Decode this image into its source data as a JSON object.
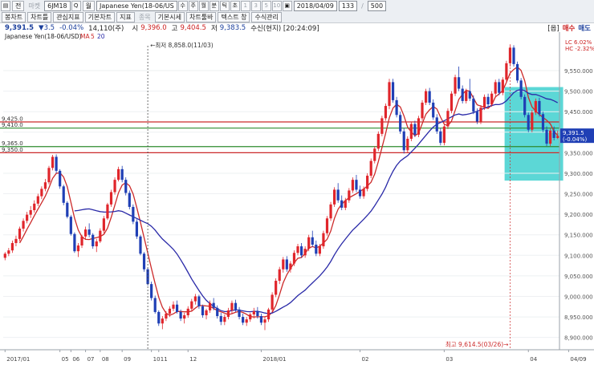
{
  "toolbar": {
    "items": [
      {
        "label": "▤",
        "kind": "sq"
      },
      {
        "label": "전",
        "kind": "btn"
      },
      {
        "label": "마켓",
        "kind": "dim"
      },
      {
        "label": "6JM18",
        "kind": "box"
      },
      {
        "label": "Q",
        "kind": "sq"
      },
      {
        "label": "월",
        "kind": "btn"
      },
      {
        "label": "Japanese Yen(18-06/US",
        "kind": "box"
      },
      {
        "label": "수",
        "kind": "sq"
      },
      {
        "label": "주",
        "kind": "sq"
      },
      {
        "label": "월",
        "kind": "sq"
      },
      {
        "label": "분",
        "kind": "sq"
      },
      {
        "label": "틱",
        "kind": "sq"
      },
      {
        "label": "초",
        "kind": "sq"
      },
      {
        "label": "1",
        "kind": "sqdim"
      },
      {
        "label": "3",
        "kind": "sqdim"
      },
      {
        "label": "5",
        "kind": "sqdim"
      },
      {
        "label": "10",
        "kind": "sqdim"
      },
      {
        "label": "▣",
        "kind": "sq"
      },
      {
        "label": "2018/04/09",
        "kind": "box"
      },
      {
        "label": "133",
        "kind": "box"
      },
      {
        "label": "/",
        "kind": "dim"
      },
      {
        "label": "500",
        "kind": "box"
      }
    ],
    "items2": [
      {
        "label": "봉차트",
        "kind": "btn"
      },
      {
        "label": "차트틀",
        "kind": "btn"
      },
      {
        "label": "관심지표",
        "kind": "btn"
      },
      {
        "label": "기본차트",
        "kind": "btn"
      },
      {
        "label": "지표",
        "kind": "btn"
      },
      {
        "label": "종목",
        "kind": "dim"
      },
      {
        "label": "기본시세",
        "kind": "btn"
      },
      {
        "label": "차트툴바",
        "kind": "btn"
      },
      {
        "label": "텍스트 창",
        "kind": "btn"
      },
      {
        "label": "수식관리",
        "kind": "btn"
      }
    ]
  },
  "quote": {
    "price": "9,391.5",
    "change": "▼3.5",
    "pct": "-0.04%",
    "volume": "14,110(주)",
    "open_label": "시",
    "open": "9,396.0",
    "high_label": "고",
    "high": "9,404.5",
    "low_label": "저",
    "low": "9,383.5",
    "session": "수신(현지) [20:24:09]",
    "menu": "[옵]",
    "buy": "매수",
    "sell": "매도"
  },
  "chart_data": {
    "type": "candlestick",
    "instrument": "Japanese Yen(18-06/USD)",
    "legend": [
      {
        "label": "MA",
        "periods": "5",
        "color": "#cc2a2a"
      },
      {
        "label": "20",
        "color": "#2a2aa8"
      }
    ],
    "ylim": [
      8870,
      9640
    ],
    "yticks": [
      8900,
      8950,
      9000,
      9050,
      9100,
      9150,
      9200,
      9250,
      9300,
      9350,
      9400,
      9450,
      9500,
      9550
    ],
    "x_labels": [
      {
        "i": 0,
        "label": "2017/01"
      },
      {
        "i": 15,
        "label": "05"
      },
      {
        "i": 18,
        "label": "06"
      },
      {
        "i": 22,
        "label": "07"
      },
      {
        "i": 26,
        "label": "08"
      },
      {
        "i": 32,
        "label": "09"
      },
      {
        "i": 40,
        "label": "10"
      },
      {
        "i": 42,
        "label": "11"
      },
      {
        "i": 50,
        "label": "12"
      },
      {
        "i": 70,
        "label": "2018/01"
      },
      {
        "i": 97,
        "label": "02"
      },
      {
        "i": 120,
        "label": "03"
      },
      {
        "i": 143,
        "label": "04"
      },
      {
        "i": 154,
        "label": "04/09"
      }
    ],
    "h_levels": [
      {
        "value": 9425.0,
        "color": "#cc2a2a"
      },
      {
        "value": 9410.0,
        "color": "#2e8b2e"
      },
      {
        "value": 9365.0,
        "color": "#2e8b2e"
      },
      {
        "value": 9350.0,
        "color": "#cc2a2a"
      }
    ],
    "h_level_labels": [
      "9,425.0",
      "9,410.0",
      "9,365.0",
      "9,350.0"
    ],
    "annotations": {
      "low": {
        "i": 39,
        "text": "최저 8,858.0(11/03)"
      },
      "high": {
        "i": 138,
        "text": "최고 9,614.5(03/26)"
      }
    },
    "current": {
      "price_text": "9,391.5",
      "change_text": "(-0.04%)",
      "value": 9391.5
    },
    "side_labels": [
      "LC 6.02%",
      "HC -2.32%"
    ],
    "highlight": {
      "i0": 137,
      "i1": 152,
      "hi": 9510,
      "lo": 9282
    },
    "candles": [
      [
        9094,
        9108,
        9088,
        9104
      ],
      [
        9104,
        9118,
        9098,
        9112
      ],
      [
        9112,
        9136,
        9106,
        9130
      ],
      [
        9130,
        9148,
        9122,
        9140
      ],
      [
        9140,
        9170,
        9134,
        9165
      ],
      [
        9165,
        9190,
        9158,
        9184
      ],
      [
        9184,
        9206,
        9178,
        9199
      ],
      [
        9199,
        9220,
        9191,
        9210
      ],
      [
        9210,
        9234,
        9204,
        9226
      ],
      [
        9226,
        9250,
        9220,
        9244
      ],
      [
        9244,
        9268,
        9237,
        9262
      ],
      [
        9262,
        9286,
        9256,
        9278
      ],
      [
        9278,
        9318,
        9273,
        9313
      ],
      [
        9313,
        9345,
        9307,
        9340
      ],
      [
        9340,
        9346,
        9300,
        9306
      ],
      [
        9306,
        9310,
        9262,
        9268
      ],
      [
        9268,
        9272,
        9222,
        9228
      ],
      [
        9228,
        9232,
        9190,
        9194
      ],
      [
        9194,
        9198,
        9148,
        9152
      ],
      [
        9152,
        9156,
        9106,
        9110
      ],
      [
        9110,
        9130,
        9096,
        9124
      ],
      [
        9124,
        9150,
        9118,
        9146
      ],
      [
        9146,
        9170,
        9140,
        9163
      ],
      [
        9163,
        9178,
        9144,
        9150
      ],
      [
        9150,
        9154,
        9116,
        9122
      ],
      [
        9122,
        9140,
        9108,
        9134
      ],
      [
        9134,
        9166,
        9130,
        9160
      ],
      [
        9160,
        9196,
        9154,
        9190
      ],
      [
        9190,
        9228,
        9186,
        9224
      ],
      [
        9224,
        9260,
        9218,
        9254
      ],
      [
        9254,
        9290,
        9248,
        9284
      ],
      [
        9284,
        9316,
        9280,
        9310
      ],
      [
        9310,
        9318,
        9278,
        9284
      ],
      [
        9284,
        9290,
        9246,
        9252
      ],
      [
        9252,
        9258,
        9212,
        9218
      ],
      [
        9218,
        9224,
        9176,
        9182
      ],
      [
        9182,
        9188,
        9140,
        9146
      ],
      [
        9146,
        9150,
        9100,
        9104
      ],
      [
        9104,
        9108,
        9060,
        9066
      ],
      [
        9066,
        9070,
        9026,
        9030
      ],
      [
        9030,
        9036,
        8990,
        8996
      ],
      [
        8996,
        9002,
        8958,
        8962
      ],
      [
        8962,
        8966,
        8928,
        8934
      ],
      [
        8934,
        8952,
        8920,
        8946
      ],
      [
        8946,
        8964,
        8940,
        8958
      ],
      [
        8958,
        8976,
        8950,
        8970
      ],
      [
        8970,
        8988,
        8964,
        8980
      ],
      [
        8980,
        8990,
        8958,
        8962
      ],
      [
        8962,
        8968,
        8940,
        8946
      ],
      [
        8946,
        8960,
        8934,
        8954
      ],
      [
        8954,
        8976,
        8948,
        8970
      ],
      [
        8970,
        8994,
        8964,
        8988
      ],
      [
        8988,
        9006,
        8980,
        9000
      ],
      [
        9000,
        9004,
        8970,
        8976
      ],
      [
        8976,
        8980,
        8948,
        8954
      ],
      [
        8954,
        8970,
        8944,
        8966
      ],
      [
        8966,
        8990,
        8960,
        8984
      ],
      [
        8984,
        8996,
        8966,
        8972
      ],
      [
        8972,
        8978,
        8946,
        8952
      ],
      [
        8952,
        8960,
        8930,
        8938
      ],
      [
        8938,
        8956,
        8930,
        8950
      ],
      [
        8950,
        8972,
        8944,
        8966
      ],
      [
        8966,
        8990,
        8958,
        8984
      ],
      [
        8984,
        8992,
        8962,
        8968
      ],
      [
        8968,
        8974,
        8944,
        8950
      ],
      [
        8950,
        8958,
        8930,
        8936
      ],
      [
        8936,
        8950,
        8928,
        8944
      ],
      [
        8944,
        8960,
        8938,
        8956
      ],
      [
        8956,
        8972,
        8946,
        8964
      ],
      [
        8964,
        8974,
        8946,
        8952
      ],
      [
        8952,
        8958,
        8930,
        8936
      ],
      [
        8936,
        8950,
        8918,
        8944
      ],
      [
        8944,
        8972,
        8938,
        8968
      ],
      [
        8968,
        9010,
        8962,
        9004
      ],
      [
        9004,
        9044,
        8998,
        9038
      ],
      [
        9038,
        9072,
        9030,
        9066
      ],
      [
        9066,
        9096,
        9058,
        9090
      ],
      [
        9090,
        9098,
        9060,
        9066
      ],
      [
        9066,
        9086,
        9058,
        9080
      ],
      [
        9080,
        9112,
        9074,
        9106
      ],
      [
        9106,
        9128,
        9100,
        9122
      ],
      [
        9122,
        9130,
        9094,
        9100
      ],
      [
        9100,
        9122,
        9094,
        9116
      ],
      [
        9116,
        9150,
        9110,
        9144
      ],
      [
        9144,
        9160,
        9120,
        9126
      ],
      [
        9126,
        9136,
        9098,
        9104
      ],
      [
        9104,
        9128,
        9098,
        9122
      ],
      [
        9122,
        9160,
        9116,
        9154
      ],
      [
        9154,
        9196,
        9148,
        9190
      ],
      [
        9190,
        9230,
        9184,
        9224
      ],
      [
        9224,
        9266,
        9218,
        9260
      ],
      [
        9260,
        9276,
        9228,
        9234
      ],
      [
        9234,
        9246,
        9210,
        9216
      ],
      [
        9216,
        9240,
        9210,
        9234
      ],
      [
        9234,
        9264,
        9228,
        9258
      ],
      [
        9258,
        9290,
        9252,
        9284
      ],
      [
        9284,
        9296,
        9254,
        9260
      ],
      [
        9260,
        9270,
        9238,
        9244
      ],
      [
        9244,
        9268,
        9238,
        9262
      ],
      [
        9262,
        9300,
        9256,
        9294
      ],
      [
        9294,
        9336,
        9288,
        9330
      ],
      [
        9330,
        9366,
        9324,
        9360
      ],
      [
        9360,
        9402,
        9354,
        9396
      ],
      [
        9396,
        9440,
        9390,
        9434
      ],
      [
        9434,
        9470,
        9428,
        9464
      ],
      [
        9464,
        9530,
        9456,
        9522
      ],
      [
        9522,
        9530,
        9472,
        9478
      ],
      [
        9478,
        9486,
        9436,
        9442
      ],
      [
        9442,
        9450,
        9396,
        9402
      ],
      [
        9402,
        9410,
        9348,
        9356
      ],
      [
        9356,
        9390,
        9350,
        9384
      ],
      [
        9384,
        9426,
        9378,
        9420
      ],
      [
        9420,
        9428,
        9388,
        9394
      ],
      [
        9394,
        9440,
        9388,
        9434
      ],
      [
        9434,
        9478,
        9428,
        9472
      ],
      [
        9472,
        9506,
        9466,
        9500
      ],
      [
        9500,
        9508,
        9466,
        9472
      ],
      [
        9472,
        9480,
        9430,
        9436
      ],
      [
        9436,
        9444,
        9396,
        9402
      ],
      [
        9402,
        9410,
        9368,
        9374
      ],
      [
        9374,
        9420,
        9368,
        9414
      ],
      [
        9414,
        9458,
        9408,
        9452
      ],
      [
        9452,
        9500,
        9446,
        9494
      ],
      [
        9494,
        9540,
        9488,
        9534
      ],
      [
        9534,
        9560,
        9500,
        9506
      ],
      [
        9506,
        9514,
        9470,
        9476
      ],
      [
        9476,
        9506,
        9470,
        9500
      ],
      [
        9500,
        9530,
        9476,
        9482
      ],
      [
        9482,
        9490,
        9444,
        9450
      ],
      [
        9450,
        9458,
        9420,
        9426
      ],
      [
        9426,
        9466,
        9420,
        9460
      ],
      [
        9460,
        9492,
        9454,
        9486
      ],
      [
        9486,
        9494,
        9462,
        9468
      ],
      [
        9468,
        9500,
        9462,
        9494
      ],
      [
        9494,
        9528,
        9488,
        9522
      ],
      [
        9522,
        9530,
        9490,
        9496
      ],
      [
        9496,
        9534,
        9490,
        9528
      ],
      [
        9528,
        9574,
        9522,
        9568
      ],
      [
        9568,
        9614,
        9560,
        9606
      ],
      [
        9606,
        9612,
        9560,
        9566
      ],
      [
        9566,
        9572,
        9520,
        9526
      ],
      [
        9526,
        9532,
        9480,
        9486
      ],
      [
        9486,
        9492,
        9436,
        9442
      ],
      [
        9442,
        9448,
        9400,
        9406
      ],
      [
        9406,
        9454,
        9400,
        9448
      ],
      [
        9448,
        9482,
        9442,
        9476
      ],
      [
        9476,
        9484,
        9438,
        9444
      ],
      [
        9444,
        9450,
        9400,
        9406
      ],
      [
        9406,
        9414,
        9366,
        9372
      ],
      [
        9372,
        9410,
        9366,
        9404
      ],
      [
        9404,
        9414,
        9380,
        9386
      ],
      [
        9386,
        9404,
        9383,
        9391
      ]
    ]
  }
}
